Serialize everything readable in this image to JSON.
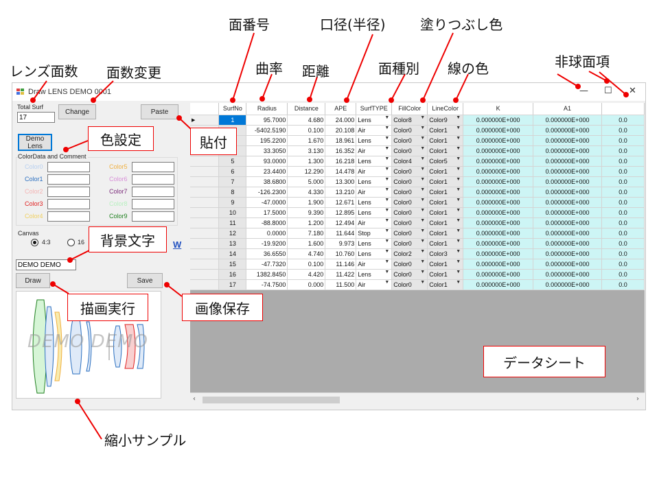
{
  "window": {
    "title": "Draw LENS DEMO 0001",
    "controls": {
      "minimize": "—",
      "maximize": "☐",
      "close": "✕"
    }
  },
  "left_panel": {
    "total_surf_label": "Total Surf",
    "total_surf_value": "17",
    "change_button": "Change",
    "paste_button": "Paste",
    "demo_lens_button": "Demo Lens",
    "color_group_label": "ColorData and Comment",
    "colors": [
      {
        "name": "Color0",
        "color": "#b8d0f0"
      },
      {
        "name": "Color1",
        "color": "#2a6fc0"
      },
      {
        "name": "Color2",
        "color": "#f4b4b4"
      },
      {
        "name": "Color3",
        "color": "#e02020"
      },
      {
        "name": "Color4",
        "color": "#f0d060"
      },
      {
        "name": "Color5",
        "color": "#f0b040"
      },
      {
        "name": "Color6",
        "color": "#d890d8"
      },
      {
        "name": "Color7",
        "color": "#7a2a7a"
      },
      {
        "name": "Color8",
        "color": "#b8f0c0"
      },
      {
        "name": "Color9",
        "color": "#208020"
      }
    ],
    "canvas_label": "Canvas",
    "radio_43": "4:3",
    "radio_169": "16",
    "partial_w": "W",
    "bg_text_value": "DEMO DEMO",
    "draw_button": "Draw",
    "save_button": "Save",
    "preview_text": "DEMO DEMO"
  },
  "grid": {
    "headers": [
      "SurfNo",
      "Radius",
      "Distance",
      "APE",
      "SurfTYPE",
      "FillColor",
      "LineColor",
      "K",
      "A1",
      ""
    ],
    "rows": [
      {
        "no": "1",
        "radius": "95.7000",
        "distance": "4.680",
        "ape": "24.000",
        "type": "Lens",
        "fill": "Color8",
        "line": "Color9",
        "k": "0.000000E+000",
        "a1": "0.000000E+000",
        "a2": "0.0"
      },
      {
        "no": "2",
        "radius": "-5402.5190",
        "distance": "0.100",
        "ape": "20.108",
        "type": "Air",
        "fill": "Color0",
        "line": "Color1",
        "k": "0.000000E+000",
        "a1": "0.000000E+000",
        "a2": "0.0"
      },
      {
        "no": "3",
        "radius": "195.2200",
        "distance": "1.670",
        "ape": "18.961",
        "type": "Lens",
        "fill": "Color0",
        "line": "Color1",
        "k": "0.000000E+000",
        "a1": "0.000000E+000",
        "a2": "0.0"
      },
      {
        "no": "4",
        "radius": "33.3050",
        "distance": "3.130",
        "ape": "16.352",
        "type": "Air",
        "fill": "Color0",
        "line": "Color1",
        "k": "0.000000E+000",
        "a1": "0.000000E+000",
        "a2": "0.0"
      },
      {
        "no": "5",
        "radius": "93.0000",
        "distance": "1.300",
        "ape": "16.218",
        "type": "Lens",
        "fill": "Color4",
        "line": "Color5",
        "k": "0.000000E+000",
        "a1": "0.000000E+000",
        "a2": "0.0"
      },
      {
        "no": "6",
        "radius": "23.4400",
        "distance": "12.290",
        "ape": "14.478",
        "type": "Air",
        "fill": "Color0",
        "line": "Color1",
        "k": "0.000000E+000",
        "a1": "0.000000E+000",
        "a2": "0.0"
      },
      {
        "no": "7",
        "radius": "38.6800",
        "distance": "5.000",
        "ape": "13.300",
        "type": "Lens",
        "fill": "Color0",
        "line": "Color1",
        "k": "0.000000E+000",
        "a1": "0.000000E+000",
        "a2": "0.0"
      },
      {
        "no": "8",
        "radius": "-126.2300",
        "distance": "4.330",
        "ape": "13.210",
        "type": "Air",
        "fill": "Color0",
        "line": "Color1",
        "k": "0.000000E+000",
        "a1": "0.000000E+000",
        "a2": "0.0"
      },
      {
        "no": "9",
        "radius": "-47.0000",
        "distance": "1.900",
        "ape": "12.671",
        "type": "Lens",
        "fill": "Color0",
        "line": "Color1",
        "k": "0.000000E+000",
        "a1": "0.000000E+000",
        "a2": "0.0"
      },
      {
        "no": "10",
        "radius": "17.5000",
        "distance": "9.390",
        "ape": "12.895",
        "type": "Lens",
        "fill": "Color0",
        "line": "Color1",
        "k": "0.000000E+000",
        "a1": "0.000000E+000",
        "a2": "0.0"
      },
      {
        "no": "11",
        "radius": "-88.8000",
        "distance": "1.200",
        "ape": "12.494",
        "type": "Air",
        "fill": "Color0",
        "line": "Color1",
        "k": "0.000000E+000",
        "a1": "0.000000E+000",
        "a2": "0.0"
      },
      {
        "no": "12",
        "radius": "0.0000",
        "distance": "7.180",
        "ape": "11.644",
        "type": "Stop",
        "fill": "Color0",
        "line": "Color1",
        "k": "0.000000E+000",
        "a1": "0.000000E+000",
        "a2": "0.0"
      },
      {
        "no": "13",
        "radius": "-19.9200",
        "distance": "1.600",
        "ape": "9.973",
        "type": "Lens",
        "fill": "Color0",
        "line": "Color1",
        "k": "0.000000E+000",
        "a1": "0.000000E+000",
        "a2": "0.0"
      },
      {
        "no": "14",
        "radius": "36.6550",
        "distance": "4.740",
        "ape": "10.760",
        "type": "Lens",
        "fill": "Color2",
        "line": "Color3",
        "k": "0.000000E+000",
        "a1": "0.000000E+000",
        "a2": "0.0"
      },
      {
        "no": "15",
        "radius": "-47.7320",
        "distance": "0.100",
        "ape": "11.146",
        "type": "Air",
        "fill": "Color0",
        "line": "Color1",
        "k": "0.000000E+000",
        "a1": "0.000000E+000",
        "a2": "0.0"
      },
      {
        "no": "16",
        "radius": "1382.8450",
        "distance": "4.420",
        "ape": "11.422",
        "type": "Lens",
        "fill": "Color0",
        "line": "Color1",
        "k": "0.000000E+000",
        "a1": "0.000000E+000",
        "a2": "0.0"
      },
      {
        "no": "17",
        "radius": "-74.7500",
        "distance": "0.000",
        "ape": "11.500",
        "type": "Air",
        "fill": "Color0",
        "line": "Color1",
        "k": "0.000000E+000",
        "a1": "0.000000E+000",
        "a2": "0.0"
      }
    ]
  },
  "annotations": {
    "surf_no": "面番号",
    "curvature": "曲率",
    "distance": "距離",
    "aperture": "口径(半径)",
    "surf_type": "面種別",
    "fill_color": "塗りつぶし色",
    "line_color": "線の色",
    "aspheric": "非球面項",
    "lens_count": "レンズ面数",
    "change_count": "面数変更",
    "color_setting": "色設定",
    "paste": "貼付",
    "bg_text": "背景文字",
    "draw": "描画実行",
    "save_image": "画像保存",
    "datasheet": "データシート",
    "thumbnail": "縮小サンプル"
  },
  "accent_colors": {
    "annotation": "#e00000",
    "selection": "#0078d7",
    "aspheric_cell": "#cdf5f5"
  }
}
